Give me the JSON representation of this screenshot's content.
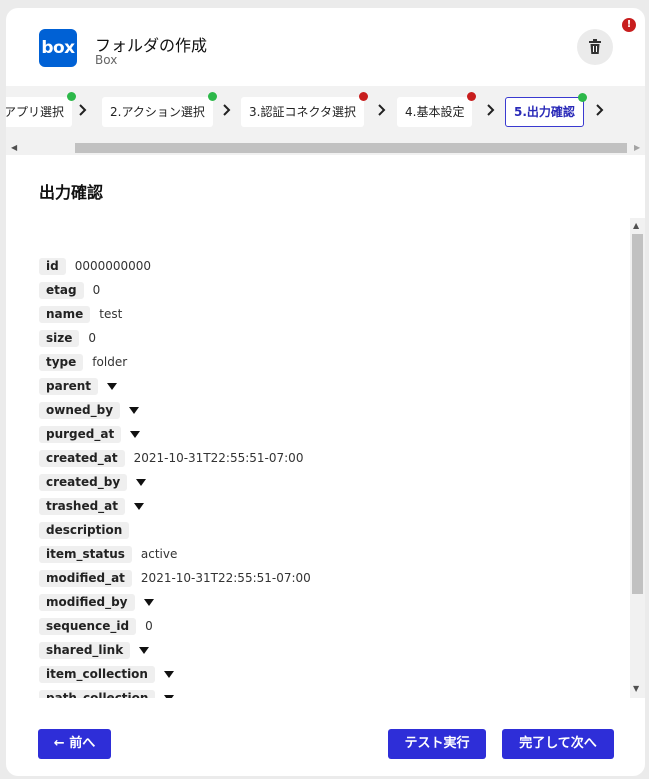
{
  "alert_badge": "!",
  "header": {
    "logo_text": "box",
    "title": "フォルダの作成",
    "subtitle": "Box"
  },
  "steps": [
    {
      "label": "アプリ選択",
      "status": "ok"
    },
    {
      "label": "2.アクション選択",
      "status": "ok"
    },
    {
      "label": "3.認証コネクタ選択",
      "status": "err"
    },
    {
      "label": "4.基本設定",
      "status": "err"
    },
    {
      "label": "5.出力確認",
      "status": "ok",
      "active": true
    }
  ],
  "section_title": "出力確認",
  "fields": [
    {
      "key": "id",
      "value": "0000000000"
    },
    {
      "key": "etag",
      "value": "0"
    },
    {
      "key": "name",
      "value": "test"
    },
    {
      "key": "size",
      "value": "0"
    },
    {
      "key": "type",
      "value": "folder"
    },
    {
      "key": "parent",
      "expandable": true
    },
    {
      "key": "owned_by",
      "expandable": true
    },
    {
      "key": "purged_at",
      "expandable": true
    },
    {
      "key": "created_at",
      "value": "2021-10-31T22:55:51-07:00"
    },
    {
      "key": "created_by",
      "expandable": true
    },
    {
      "key": "trashed_at",
      "expandable": true
    },
    {
      "key": "description",
      "value": ""
    },
    {
      "key": "item_status",
      "value": "active"
    },
    {
      "key": "modified_at",
      "value": "2021-10-31T22:55:51-07:00"
    },
    {
      "key": "modified_by",
      "expandable": true
    },
    {
      "key": "sequence_id",
      "value": "0"
    },
    {
      "key": "shared_link",
      "expandable": true
    },
    {
      "key": "item_collection",
      "expandable": true
    },
    {
      "key": "path_collection",
      "expandable": true
    }
  ],
  "buttons": {
    "prev": "← 前へ",
    "test": "テスト実行",
    "next": "完了して次へ"
  },
  "colors": {
    "accent": "#2e2ed8",
    "ok": "#2db84a",
    "error": "#c81e1e",
    "box_brand": "#0061d5"
  },
  "icons": {
    "trash": "trash-icon",
    "step_separator": "chevron-right-icon",
    "expand": "caret-down-icon"
  }
}
